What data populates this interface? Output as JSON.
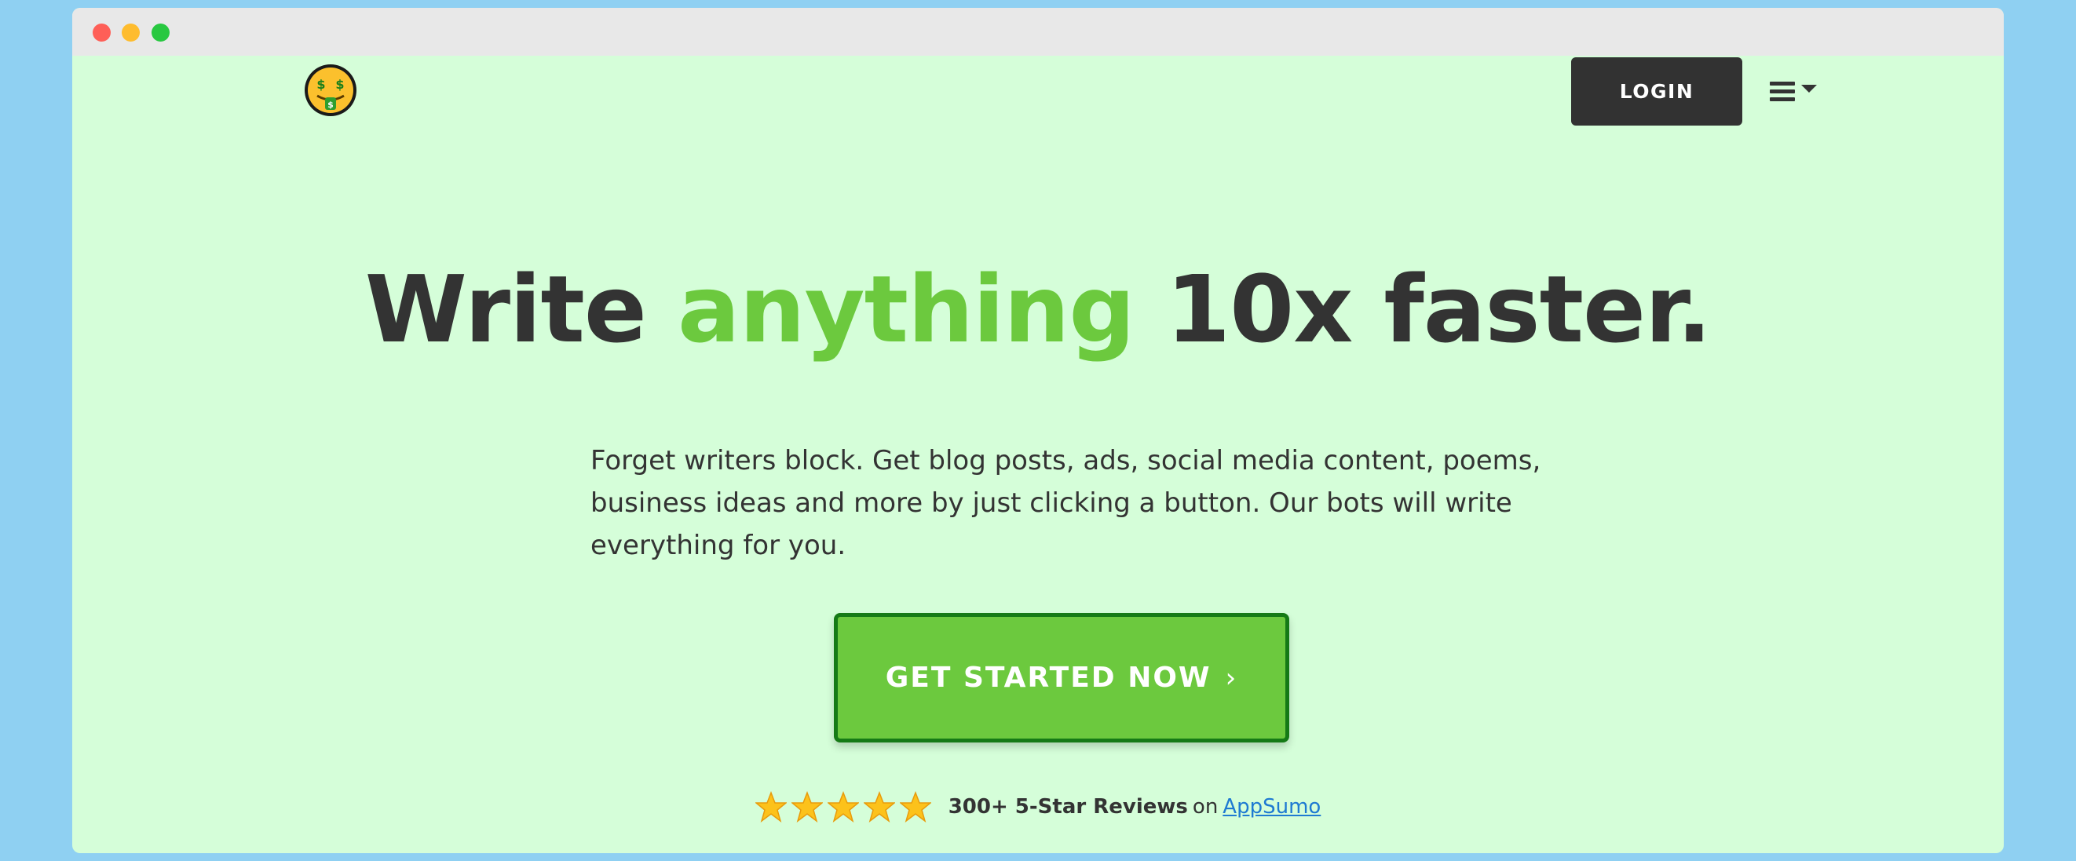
{
  "window": {
    "controls": [
      "close",
      "minimize",
      "zoom"
    ]
  },
  "header": {
    "logo_icon": "money-mouth-face-icon",
    "login_label": "LOGIN",
    "menu_icon": "hamburger-menu-icon"
  },
  "hero": {
    "headline_part1": "Write ",
    "headline_accent": "anything",
    "headline_part2": " 10x faster.",
    "description": "Forget writers block. Get blog posts, ads, social media content, poems, business ideas and more by just clicking a button. Our bots will write everything for you.",
    "cta_label": "GET STARTED NOW",
    "cta_icon": "chevron-right-icon"
  },
  "reviews": {
    "star_count": 5,
    "star_icon": "star-icon",
    "summary": "300+ 5-Star Reviews",
    "connector": "on",
    "source_link": "AppSumo"
  },
  "colors": {
    "page_background": "#8fd0f2",
    "window_background": "#d5fed9",
    "accent_green": "#6cc93e",
    "cta_border": "#157a16",
    "dark_text": "#333333",
    "login_background": "#323232",
    "link_blue": "#1e7ad2"
  }
}
